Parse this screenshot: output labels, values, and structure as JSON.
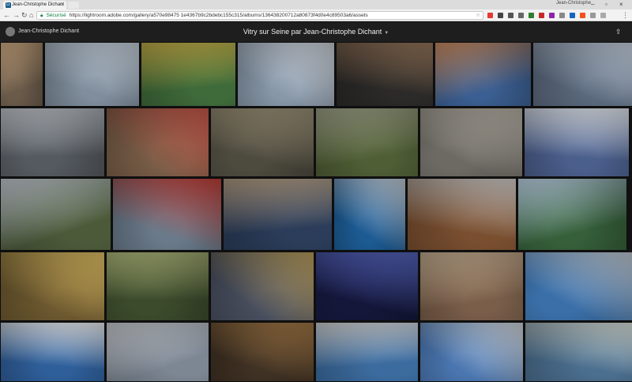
{
  "browser": {
    "tab_title": "Jean-Christophe Dichant",
    "tab_favicon": "Lr",
    "profile_name": "Jean-Christophe",
    "url_secure_label": "Sécurisé",
    "url": "https://lightroom.adobe.com/gallery/a570e98475 1e4367b9c2bdebc155c315/albums/136438200712a80873f4d0e4c89503a6/assets"
  },
  "lightroom": {
    "owner": "Jean-Christophe Dichant",
    "album_title": "Vitry sur Seine par Jean-Christophe Dichant",
    "share_icon": "share-icon"
  },
  "extensions": [
    "#e53935",
    "#444444",
    "#555555",
    "#666666",
    "#2e7d32",
    "#c62828",
    "#8e24aa",
    "#888888",
    "#1565c0",
    "#f4511e",
    "#999999",
    "#aaaaaa"
  ],
  "photos": [
    {
      "c1": "#6a5a4a",
      "c2": "#c1a07a"
    },
    {
      "c1": "#7f8d9c",
      "c2": "#c9d4df"
    },
    {
      "c1": "#3f6b3a",
      "c2": "#c7b24a"
    },
    {
      "c1": "#8797a8",
      "c2": "#d8dee5"
    },
    {
      "c1": "#2c2a28",
      "c2": "#8d6f55"
    },
    {
      "c1": "#3b5f92",
      "c2": "#c98a5d"
    },
    {
      "c1": "#5b6a7e",
      "c2": "#bfc9d6"
    },
    {
      "c1": "#555a60",
      "c2": "#b7bcc2"
    },
    {
      "c1": "#7a5f48",
      "c2": "#c35548"
    },
    {
      "c1": "#4d4a3e",
      "c2": "#a59a7e"
    },
    {
      "c1": "#4f5e35",
      "c2": "#a1a58b"
    },
    {
      "c1": "#6d6a64",
      "c2": "#c6c0b4"
    },
    {
      "c1": "#4b5f8c",
      "c2": "#e5eaf0"
    },
    {
      "c1": "#4c5a3a",
      "c2": "#cfd6df"
    },
    {
      "c1": "#6a7a8a",
      "c2": "#c9423a"
    },
    {
      "c1": "#2b3d5a",
      "c2": "#b7a187"
    },
    {
      "c1": "#1c5a92",
      "c2": "#cfd9e3"
    },
    {
      "c1": "#7a4f30",
      "c2": "#c8c4c0"
    },
    {
      "c1": "#36603a",
      "c2": "#bdd3e6"
    },
    {
      "c1": "#6e5a30",
      "c2": "#d8b860"
    },
    {
      "c1": "#3c4b2c",
      "c2": "#a4ad73"
    },
    {
      "c1": "#4a5060",
      "c2": "#b59a5a"
    },
    {
      "c1": "#14173a",
      "c2": "#5a6ac8"
    },
    {
      "c1": "#7a5e4a",
      "c2": "#c9b294"
    },
    {
      "c1": "#3a6fa8",
      "c2": "#d0d9e2"
    },
    {
      "c1": "#2f5f9a",
      "c2": "#f0f2f5"
    },
    {
      "c1": "#7d8794",
      "c2": "#d3d7db"
    },
    {
      "c1": "#3f3123",
      "c2": "#a97d48"
    },
    {
      "c1": "#3c6c9f",
      "c2": "#d6d8da"
    },
    {
      "c1": "#4a76b0",
      "c2": "#dfe5eb"
    },
    {
      "c1": "#4b6f8f",
      "c2": "#cfd6cf"
    }
  ]
}
